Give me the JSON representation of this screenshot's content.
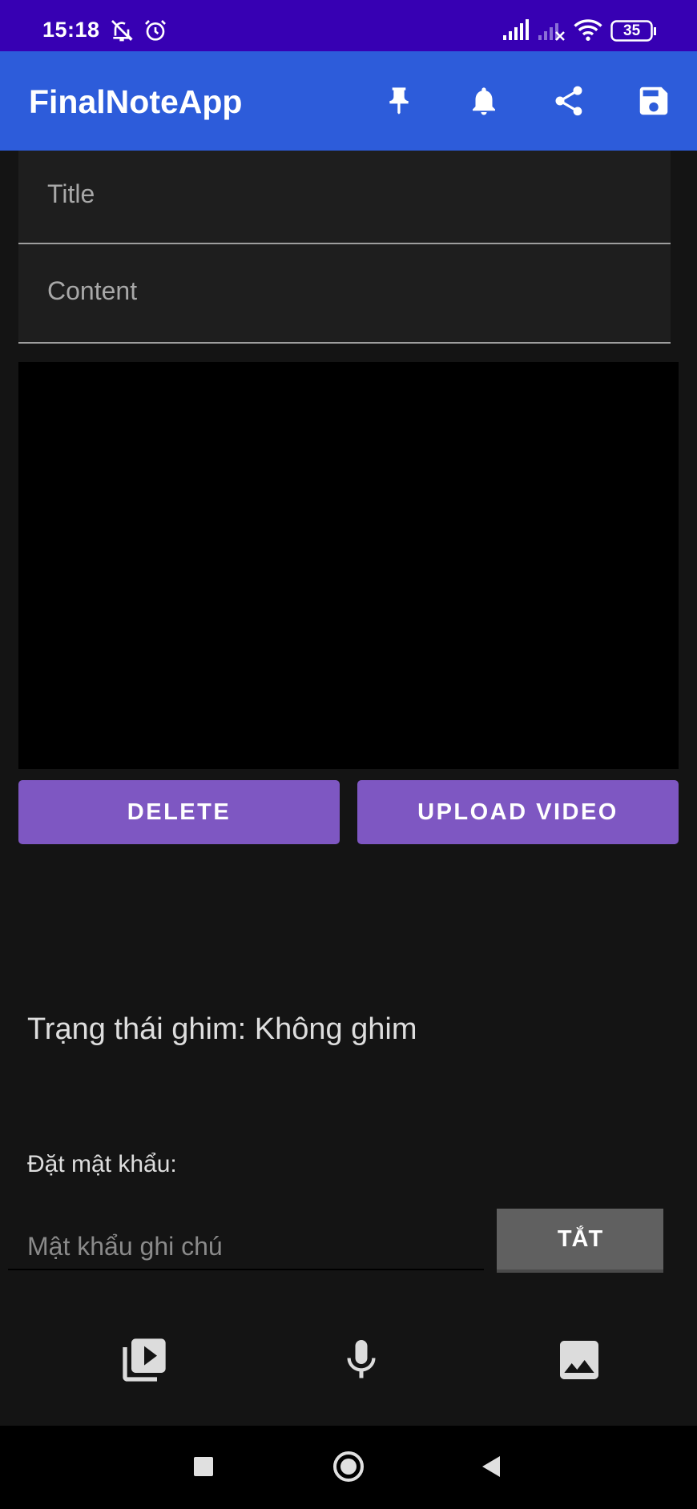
{
  "status_bar": {
    "time": "15:18",
    "battery": "35"
  },
  "app_bar": {
    "title": "FinalNoteApp",
    "actions": [
      "pin-icon",
      "bell-icon",
      "share-icon",
      "save-icon"
    ]
  },
  "note": {
    "title_hint": "Title",
    "content_hint": "Content"
  },
  "buttons": {
    "delete": "DELETE",
    "upload_video": "UPLOAD VIDEO"
  },
  "pin_status": "Trạng thái ghim: Không ghim",
  "password": {
    "label": "Đặt mật khẩu:",
    "placeholder": "Mật khẩu ghi chú",
    "toggle": "TẮT"
  },
  "colors": {
    "status_bar": "#3700b3",
    "app_bar": "#2d5cda",
    "button": "#7e57c2",
    "background": "#141414"
  }
}
